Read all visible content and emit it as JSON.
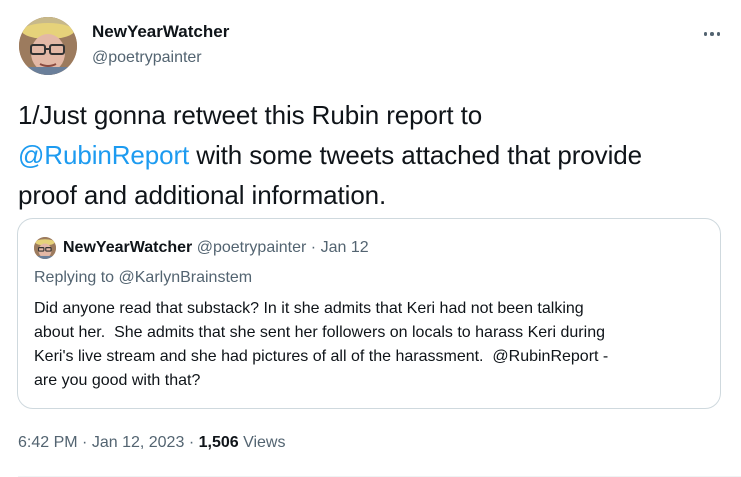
{
  "author": {
    "name": "NewYearWatcher",
    "handle": "@poetrypainter"
  },
  "tweet": {
    "line1": "1/Just gonna retweet this Rubin report to",
    "mention": "@RubinReport",
    "line2_rest": " with some tweets attached that provide",
    "line3": "proof and additional information."
  },
  "quote": {
    "name": "NewYearWatcher",
    "handle": "@poetrypainter",
    "separator": "·",
    "date": "Jan 12",
    "replying_prefix": "Replying to ",
    "replying_to": "@KarlynBrainstem",
    "body_lines": [
      "Did anyone read that substack? In it she admits that Keri had not been talking",
      "about her.  She admits that she sent her followers on locals to harass Keri during",
      "Keri's live stream and she had pictures of all of the harassment.  @RubinReport -",
      "are you good with that?"
    ]
  },
  "meta": {
    "time": "6:42 PM",
    "separator1": "·",
    "date": "Jan 12, 2023",
    "separator2": "·",
    "views_count": "1,506",
    "views_label": "Views"
  },
  "icons": {
    "more": "more-horizontal-icon"
  },
  "colors": {
    "accent": "#1d9bf0",
    "secondary_text": "#536471",
    "primary_text": "#0f1419",
    "border": "#cfd9de"
  }
}
